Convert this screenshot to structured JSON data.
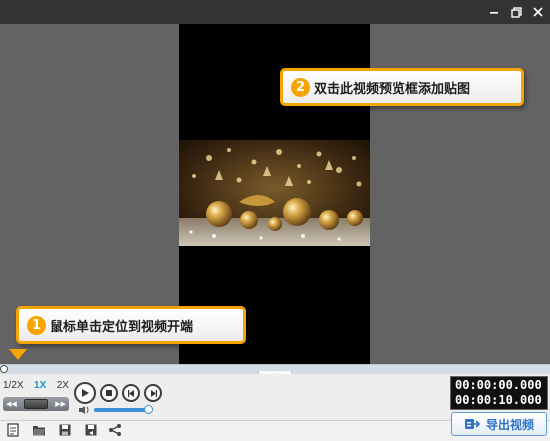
{
  "window": {
    "controls": [
      "minimize-icon",
      "restore-icon",
      "close-icon"
    ]
  },
  "preview": {
    "callouts": [
      {
        "num": "2",
        "text": "双击此视频预览框添加贴图"
      },
      {
        "num": "1",
        "text": "鼠标单击定位到视频开端"
      }
    ]
  },
  "playback": {
    "speeds": [
      "1/2X",
      "1X",
      "2X"
    ],
    "selected_speed": "1X",
    "buttons": [
      "play-icon",
      "stop-icon",
      "previous-frame-icon",
      "next-frame-icon"
    ],
    "volume": 0.92
  },
  "time": {
    "current": "00:00:00.000",
    "total": "00:00:10.000"
  },
  "bottom_tools": [
    "new-project-icon",
    "open-folder-icon",
    "save-icon",
    "save-as-icon",
    "share-icon"
  ],
  "export": {
    "label": "导出视频"
  },
  "colors": {
    "accent": "#f6a400",
    "brand_blue": "#2c72c5",
    "titlebar": "#333333"
  }
}
